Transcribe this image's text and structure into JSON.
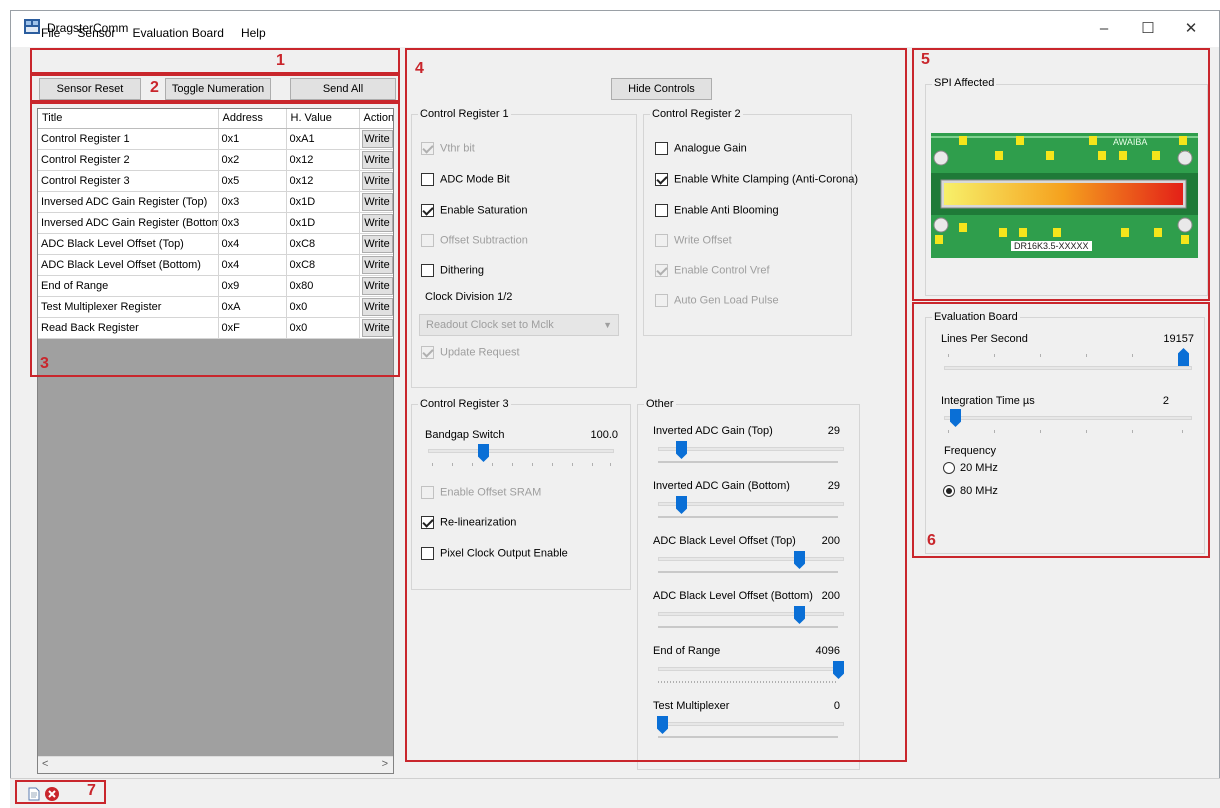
{
  "window": {
    "title": "DragsterComm",
    "minimize": "–",
    "maximize": "☐",
    "close": "✕"
  },
  "menu": [
    "File",
    "Sensor",
    "Evaluation Board",
    "Help"
  ],
  "annotations": {
    "a1": "1",
    "a2": "2",
    "a3": "3",
    "a4": "4",
    "a5": "5",
    "a6": "6",
    "a7": "7"
  },
  "toolbar": {
    "sensor_reset": "Sensor Reset",
    "toggle_numeration": "Toggle Numeration",
    "send_all": "Send All"
  },
  "registers": {
    "headers": [
      "Title",
      "Address",
      "H. Value",
      "Action"
    ],
    "rows": [
      {
        "title": "Control Register 1",
        "address": "0x1",
        "value": "0xA1",
        "action": "Write"
      },
      {
        "title": "Control Register 2",
        "address": "0x2",
        "value": "0x12",
        "action": "Write"
      },
      {
        "title": "Control Register 3",
        "address": "0x5",
        "value": "0x12",
        "action": "Write"
      },
      {
        "title": "Inversed ADC Gain Register (Top)",
        "address": "0x3",
        "value": "0x1D",
        "action": "Write"
      },
      {
        "title": "Inversed ADC Gain Register (Bottom)",
        "address": "0x3",
        "value": "0x1D",
        "action": "Write"
      },
      {
        "title": "ADC Black Level Offset (Top)",
        "address": "0x4",
        "value": "0xC8",
        "action": "Write"
      },
      {
        "title": "ADC Black Level Offset (Bottom)",
        "address": "0x4",
        "value": "0xC8",
        "action": "Write"
      },
      {
        "title": "End of Range",
        "address": "0x9",
        "value": "0x80",
        "action": "Write"
      },
      {
        "title": "Test Multiplexer Register",
        "address": "0xA",
        "value": "0x0",
        "action": "Write"
      },
      {
        "title": "Read Back Register",
        "address": "0xF",
        "value": "0x0",
        "action": "Write"
      }
    ]
  },
  "hide_controls": "Hide Controls",
  "cr1": {
    "title": "Control Register 1",
    "vthr": "Vthr bit",
    "adc_mode": "ADC Mode Bit",
    "saturation": "Enable Saturation",
    "offset_sub": "Offset Subtraction",
    "dithering": "Dithering",
    "clock_div": "Clock Division 1/2",
    "clock_combo": "Readout Clock set to Mclk",
    "update": "Update Request"
  },
  "cr2": {
    "title": "Control Register 2",
    "analogue": "Analogue Gain",
    "white_clamp": "Enable White Clamping (Anti-Corona)",
    "anti_bloom": "Enable Anti Blooming",
    "write_offset": "Write Offset",
    "ctrl_vref": "Enable Control Vref",
    "auto_gen": "Auto Gen Load Pulse"
  },
  "cr3": {
    "title": "Control Register 3",
    "bandgap": "Bandgap Switch",
    "bandgap_value": "100.0",
    "offset_sram": "Enable Offset SRAM",
    "relin": "Re-linearization",
    "pixclk": "Pixel Clock Output Enable"
  },
  "other": {
    "title": "Other",
    "sliders": [
      {
        "label": "Inverted ADC Gain (Top)",
        "value": "29"
      },
      {
        "label": "Inverted ADC Gain (Bottom)",
        "value": "29"
      },
      {
        "label": "ADC Black Level Offset (Top)",
        "value": "200"
      },
      {
        "label": "ADC Black Level Offset (Bottom)",
        "value": "200"
      },
      {
        "label": "End of Range",
        "value": "4096"
      },
      {
        "label": "Test Multiplexer",
        "value": "0"
      }
    ]
  },
  "spi": {
    "title": "SPI Affected",
    "chip_brand": "AWAIBA",
    "chip_label": "DR16K3.5-XXXXX"
  },
  "eval": {
    "title": "Evaluation Board",
    "lines_label": "Lines Per Second",
    "lines_value": "19157",
    "integration_label": "Integration Time µs",
    "integration_value": "2",
    "freq_label": "Frequency",
    "f20": "20 MHz",
    "f80": "80 MHz"
  },
  "colors": {
    "annotation": "#c9262c",
    "slider_thumb": "#0a6fd6",
    "chip_green": "#2f9e4c"
  }
}
